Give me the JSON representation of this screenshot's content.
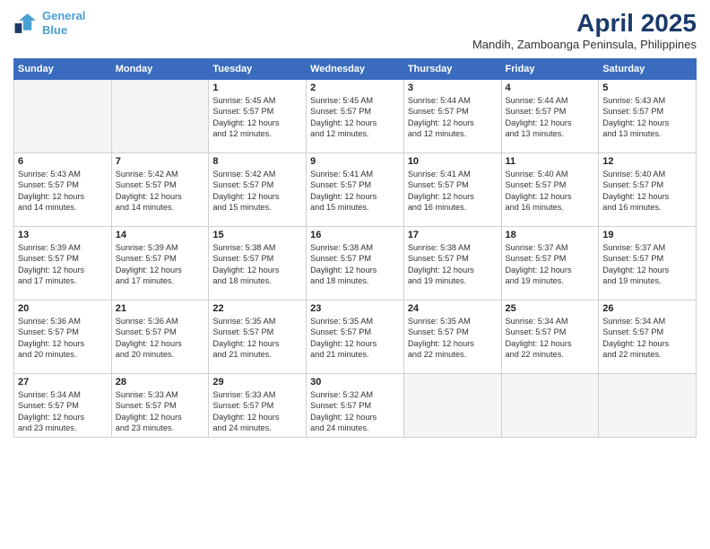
{
  "logo": {
    "line1": "General",
    "line2": "Blue"
  },
  "title": "April 2025",
  "subtitle": "Mandih, Zamboanga Peninsula, Philippines",
  "weekdays": [
    "Sunday",
    "Monday",
    "Tuesday",
    "Wednesday",
    "Thursday",
    "Friday",
    "Saturday"
  ],
  "weeks": [
    [
      {
        "day": "",
        "info": ""
      },
      {
        "day": "",
        "info": ""
      },
      {
        "day": "1",
        "info": "Sunrise: 5:45 AM\nSunset: 5:57 PM\nDaylight: 12 hours\nand 12 minutes."
      },
      {
        "day": "2",
        "info": "Sunrise: 5:45 AM\nSunset: 5:57 PM\nDaylight: 12 hours\nand 12 minutes."
      },
      {
        "day": "3",
        "info": "Sunrise: 5:44 AM\nSunset: 5:57 PM\nDaylight: 12 hours\nand 12 minutes."
      },
      {
        "day": "4",
        "info": "Sunrise: 5:44 AM\nSunset: 5:57 PM\nDaylight: 12 hours\nand 13 minutes."
      },
      {
        "day": "5",
        "info": "Sunrise: 5:43 AM\nSunset: 5:57 PM\nDaylight: 12 hours\nand 13 minutes."
      }
    ],
    [
      {
        "day": "6",
        "info": "Sunrise: 5:43 AM\nSunset: 5:57 PM\nDaylight: 12 hours\nand 14 minutes."
      },
      {
        "day": "7",
        "info": "Sunrise: 5:42 AM\nSunset: 5:57 PM\nDaylight: 12 hours\nand 14 minutes."
      },
      {
        "day": "8",
        "info": "Sunrise: 5:42 AM\nSunset: 5:57 PM\nDaylight: 12 hours\nand 15 minutes."
      },
      {
        "day": "9",
        "info": "Sunrise: 5:41 AM\nSunset: 5:57 PM\nDaylight: 12 hours\nand 15 minutes."
      },
      {
        "day": "10",
        "info": "Sunrise: 5:41 AM\nSunset: 5:57 PM\nDaylight: 12 hours\nand 16 minutes."
      },
      {
        "day": "11",
        "info": "Sunrise: 5:40 AM\nSunset: 5:57 PM\nDaylight: 12 hours\nand 16 minutes."
      },
      {
        "day": "12",
        "info": "Sunrise: 5:40 AM\nSunset: 5:57 PM\nDaylight: 12 hours\nand 16 minutes."
      }
    ],
    [
      {
        "day": "13",
        "info": "Sunrise: 5:39 AM\nSunset: 5:57 PM\nDaylight: 12 hours\nand 17 minutes."
      },
      {
        "day": "14",
        "info": "Sunrise: 5:39 AM\nSunset: 5:57 PM\nDaylight: 12 hours\nand 17 minutes."
      },
      {
        "day": "15",
        "info": "Sunrise: 5:38 AM\nSunset: 5:57 PM\nDaylight: 12 hours\nand 18 minutes."
      },
      {
        "day": "16",
        "info": "Sunrise: 5:38 AM\nSunset: 5:57 PM\nDaylight: 12 hours\nand 18 minutes."
      },
      {
        "day": "17",
        "info": "Sunrise: 5:38 AM\nSunset: 5:57 PM\nDaylight: 12 hours\nand 19 minutes."
      },
      {
        "day": "18",
        "info": "Sunrise: 5:37 AM\nSunset: 5:57 PM\nDaylight: 12 hours\nand 19 minutes."
      },
      {
        "day": "19",
        "info": "Sunrise: 5:37 AM\nSunset: 5:57 PM\nDaylight: 12 hours\nand 19 minutes."
      }
    ],
    [
      {
        "day": "20",
        "info": "Sunrise: 5:36 AM\nSunset: 5:57 PM\nDaylight: 12 hours\nand 20 minutes."
      },
      {
        "day": "21",
        "info": "Sunrise: 5:36 AM\nSunset: 5:57 PM\nDaylight: 12 hours\nand 20 minutes."
      },
      {
        "day": "22",
        "info": "Sunrise: 5:35 AM\nSunset: 5:57 PM\nDaylight: 12 hours\nand 21 minutes."
      },
      {
        "day": "23",
        "info": "Sunrise: 5:35 AM\nSunset: 5:57 PM\nDaylight: 12 hours\nand 21 minutes."
      },
      {
        "day": "24",
        "info": "Sunrise: 5:35 AM\nSunset: 5:57 PM\nDaylight: 12 hours\nand 22 minutes."
      },
      {
        "day": "25",
        "info": "Sunrise: 5:34 AM\nSunset: 5:57 PM\nDaylight: 12 hours\nand 22 minutes."
      },
      {
        "day": "26",
        "info": "Sunrise: 5:34 AM\nSunset: 5:57 PM\nDaylight: 12 hours\nand 22 minutes."
      }
    ],
    [
      {
        "day": "27",
        "info": "Sunrise: 5:34 AM\nSunset: 5:57 PM\nDaylight: 12 hours\nand 23 minutes."
      },
      {
        "day": "28",
        "info": "Sunrise: 5:33 AM\nSunset: 5:57 PM\nDaylight: 12 hours\nand 23 minutes."
      },
      {
        "day": "29",
        "info": "Sunrise: 5:33 AM\nSunset: 5:57 PM\nDaylight: 12 hours\nand 24 minutes."
      },
      {
        "day": "30",
        "info": "Sunrise: 5:32 AM\nSunset: 5:57 PM\nDaylight: 12 hours\nand 24 minutes."
      },
      {
        "day": "",
        "info": ""
      },
      {
        "day": "",
        "info": ""
      },
      {
        "day": "",
        "info": ""
      }
    ]
  ]
}
